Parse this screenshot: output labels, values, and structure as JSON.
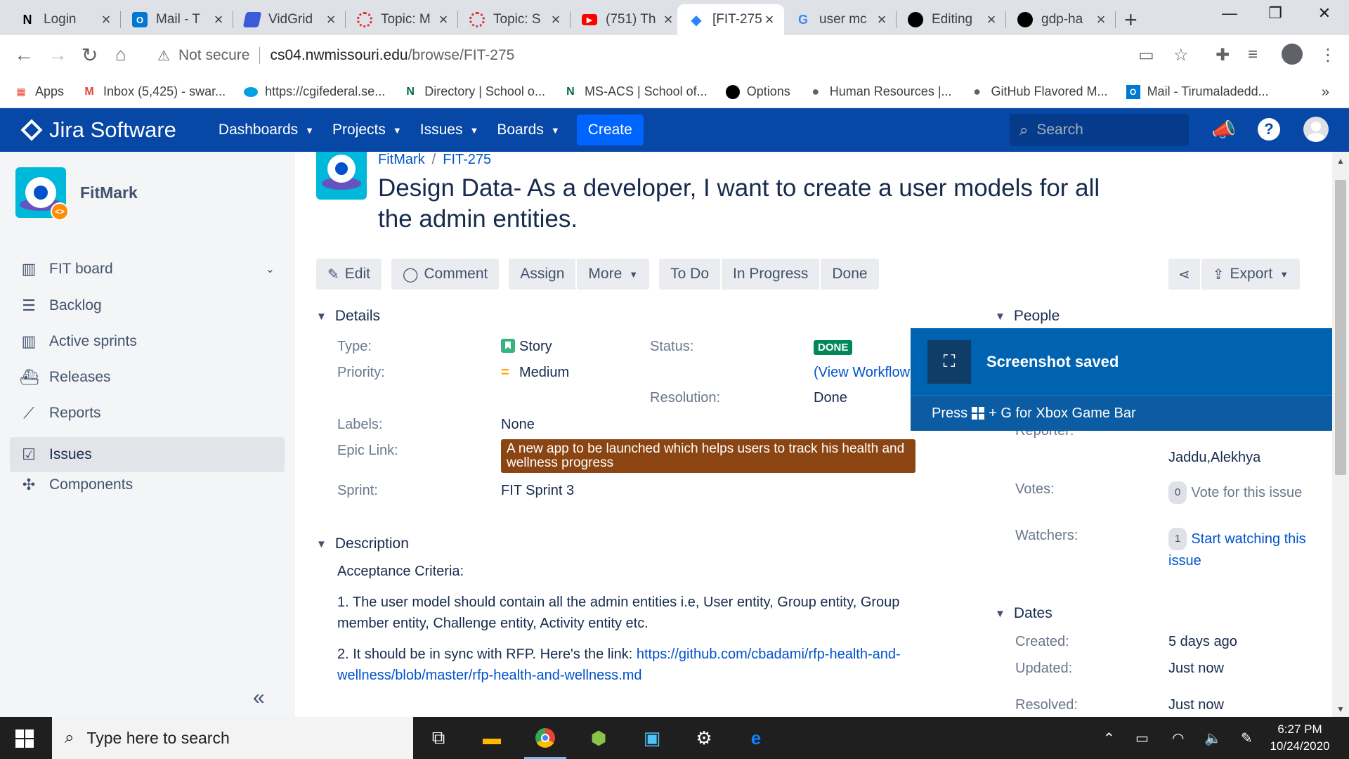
{
  "browser": {
    "tabs": [
      {
        "label": "Login",
        "icon": "notion-icon",
        "color": "#000000"
      },
      {
        "label": "Mail - T",
        "icon": "outlook-icon",
        "color": "#0078d4"
      },
      {
        "label": "VidGrid",
        "icon": "vidgrid-icon",
        "color": "#3b5bdb"
      },
      {
        "label": "Topic: M",
        "icon": "topic-icon",
        "color": "#e03131"
      },
      {
        "label": "Topic: S",
        "icon": "topic-icon",
        "color": "#e03131"
      },
      {
        "label": "(751) Th",
        "icon": "youtube-icon",
        "color": "#ff0000"
      },
      {
        "label": "[FIT-275",
        "icon": "jira-icon",
        "color": "#2684ff"
      },
      {
        "label": "user mc",
        "icon": "google-icon",
        "color": "#4285f4"
      },
      {
        "label": "Editing",
        "icon": "github-icon",
        "color": "#000000"
      },
      {
        "label": "gdp-ha",
        "icon": "github-icon",
        "color": "#000000"
      }
    ],
    "address": {
      "security": "Not secure",
      "host": "cs04.nwmissouri.edu",
      "path": "/browse/FIT-275"
    },
    "bookmarks": [
      {
        "label": "Apps",
        "icon": "apps-grid-icon"
      },
      {
        "label": "Inbox (5,425) - swar...",
        "icon": "gmail-icon"
      },
      {
        "label": "https://cgifederal.se...",
        "icon": "salesforce-icon"
      },
      {
        "label": "Directory | School o...",
        "icon": "nwmissouri-icon"
      },
      {
        "label": "MS-ACS | School of...",
        "icon": "nwmissouri-icon"
      },
      {
        "label": "Options",
        "icon": "github-icon"
      },
      {
        "label": "Human Resources |...",
        "icon": "globe-icon"
      },
      {
        "label": "GitHub Flavored M...",
        "icon": "globe-icon"
      },
      {
        "label": "Mail - Tirumaladedd...",
        "icon": "outlook-icon"
      }
    ]
  },
  "jira": {
    "product": "Jira Software",
    "nav": [
      "Dashboards",
      "Projects",
      "Issues",
      "Boards"
    ],
    "create_label": "Create",
    "search_placeholder": "Search",
    "brand_color": "#0747a6"
  },
  "sidebar": {
    "project_name": "FitMark",
    "items": [
      {
        "label": "FIT board",
        "icon": "board-icon"
      },
      {
        "label": "Backlog",
        "icon": "backlog-icon"
      },
      {
        "label": "Active sprints",
        "icon": "sprint-board-icon"
      },
      {
        "label": "Releases",
        "icon": "ship-icon"
      },
      {
        "label": "Reports",
        "icon": "chart-line-icon"
      },
      {
        "label": "Issues",
        "icon": "issues-icon"
      },
      {
        "label": "Components",
        "icon": "puzzle-icon"
      }
    ],
    "active_item": "Issues"
  },
  "issue": {
    "project_crumb": "FitMark",
    "key": "FIT-275",
    "title": "Design Data- As a developer, I want to create a user models for all the admin entities.",
    "actions": {
      "edit": "Edit",
      "comment": "Comment",
      "assign": "Assign",
      "more": "More",
      "todo": "To Do",
      "in_progress": "In Progress",
      "done": "Done",
      "export": "Export"
    },
    "details": {
      "heading": "Details",
      "type_label": "Type:",
      "type_value": "Story",
      "priority_label": "Priority:",
      "priority_value": "Medium",
      "status_label": "Status:",
      "status_value": "DONE",
      "view_workflow": "(View Workflow",
      "resolution_label": "Resolution:",
      "resolution_value": "Done",
      "labels_label": "Labels:",
      "labels_value": "None",
      "epic_label": "Epic Link:",
      "epic_value": "A new app to be launched which helps users to track his health and wellness progress",
      "sprint_label": "Sprint:",
      "sprint_value": "FIT Sprint 3"
    },
    "description": {
      "heading": "Description",
      "line1": "Acceptance Criteria:",
      "line2": "1.  The user model should contain all the admin entities i.e, User entity, Group entity, Group member entity, Challenge entity, Activity entity etc.",
      "line3_prefix": "2. It should be in sync with RFP. Here's the link: ",
      "line3_link": "https://github.com/cbadami/rfp-health-and-wellness/blob/master/rfp-health-and-wellness.md"
    },
    "people": {
      "heading": "People",
      "reporter_label": "Reporter:",
      "reporter_value": "Jaddu,Alekhya",
      "votes_label": "Votes:",
      "votes_count": "0",
      "votes_link": "Vote for this issue",
      "watchers_label": "Watchers:",
      "watchers_count": "1",
      "watchers_link": "Start watching this issue"
    },
    "dates": {
      "heading": "Dates",
      "created_label": "Created:",
      "created_value": "5 days ago",
      "updated_label": "Updated:",
      "updated_value": "Just now",
      "resolved_label": "Resolved:",
      "resolved_value": "Just now"
    }
  },
  "toast": {
    "title": "Screenshot saved",
    "sub_prefix": "Press",
    "sub_suffix": "+ G for Xbox Game Bar",
    "color": "#0063b1"
  },
  "taskbar": {
    "search_placeholder": "Type here to search",
    "time": "6:27 PM",
    "date": "10/24/2020"
  }
}
